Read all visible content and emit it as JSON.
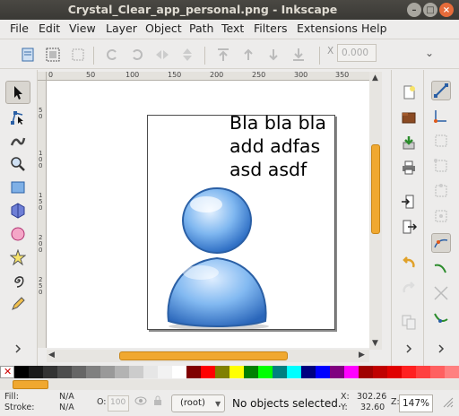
{
  "window": {
    "title": "Crystal_Clear_app_personal.png - Inkscape",
    "controls": {
      "minimize": "–",
      "maximize": "□",
      "close": "×"
    }
  },
  "menu": [
    {
      "label": "File",
      "icon": null
    },
    {
      "label": "Edit"
    },
    {
      "label": "View"
    },
    {
      "label": "Layer"
    },
    {
      "label": "Object"
    },
    {
      "label": "Path"
    },
    {
      "label": "Text"
    },
    {
      "label": "Filters"
    },
    {
      "label": "Extensions"
    },
    {
      "label": "Help"
    }
  ],
  "toolbar": {
    "x_label": "X",
    "x_value": "0.000",
    "more": "⌄"
  },
  "rulers": {
    "h_labels": [
      "0",
      "50",
      "100",
      "150",
      "200",
      "250",
      "300",
      "350"
    ],
    "v_labels": [
      "50",
      "100",
      "150",
      "200",
      "250"
    ]
  },
  "canvas": {
    "text_lines": [
      "Bla bla bla",
      "add adfas",
      "asd asdf"
    ]
  },
  "scroll": {
    "up": "▲",
    "down": "▼",
    "left": "◀",
    "right": "▶",
    "v_fraction": 0.37,
    "h_fraction": 0.52
  },
  "palette": {
    "none_symbol": "✕",
    "colors": [
      "#000000",
      "#1a1a1a",
      "#333333",
      "#4d4d4d",
      "#666666",
      "#808080",
      "#999999",
      "#b3b3b3",
      "#cccccc",
      "#e6e6e6",
      "#f2f2f2",
      "#ffffff",
      "#800000",
      "#ff0000",
      "#808000",
      "#ffff00",
      "#008000",
      "#00ff00",
      "#008080",
      "#00ffff",
      "#000080",
      "#0000ff",
      "#800080",
      "#ff00ff",
      "#a00000",
      "#c00000",
      "#e00000",
      "#ff2020",
      "#ff4040",
      "#ff6060",
      "#ff8080"
    ]
  },
  "status": {
    "fill_label": "Fill:",
    "fill_value": "N/A",
    "stroke_label": "Stroke:",
    "stroke_value": "N/A",
    "opacity_label": "O:",
    "opacity_value": "100",
    "layer": "(root)",
    "message": "No objects selected.",
    "x_label": "X:",
    "x_value": "302.26",
    "y_label": "Y:",
    "y_value": "32.60",
    "zoom_label": "Z:",
    "zoom_value": "147%"
  },
  "tools": [
    "selector-tool",
    "node-tool",
    "tweak-tool",
    "zoom-tool",
    "rectangle-tool",
    "3dbox-tool",
    "ellipse-tool",
    "star-tool",
    "spiral-tool",
    "pencil-tool"
  ],
  "colors": {
    "accent": "#f0a830",
    "titlebar": "#3f3e3a",
    "close": "#e66b3a"
  }
}
